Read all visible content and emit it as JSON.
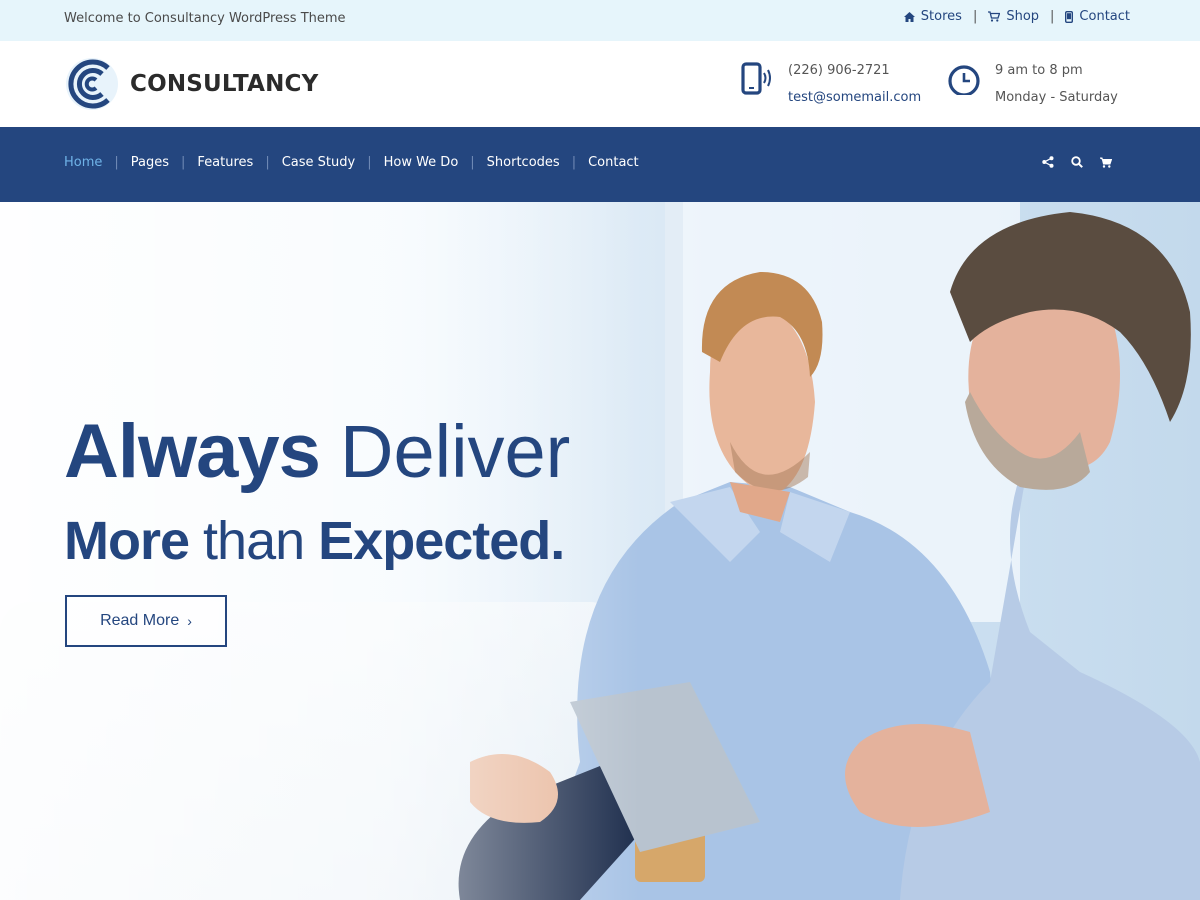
{
  "topbar": {
    "welcome": "Welcome to Consultancy WordPress Theme",
    "links": [
      {
        "label": "Stores",
        "icon": "home-icon"
      },
      {
        "label": "Shop",
        "icon": "cart-icon"
      },
      {
        "label": "Contact",
        "icon": "mobile-icon"
      }
    ],
    "separator": "|"
  },
  "header": {
    "logo_text": "CONSULTANCY",
    "phone": "(226) 906-2721",
    "email": "test@somemail.com",
    "hours": "9 am to 8 pm",
    "days": "Monday - Saturday"
  },
  "nav": {
    "items": [
      "Home",
      "Pages",
      "Features",
      "Case Study",
      "How We Do",
      "Shortcodes",
      "Contact"
    ],
    "active": "Home",
    "separator": "|",
    "icons": [
      "share-icon",
      "search-icon",
      "cart-icon"
    ]
  },
  "hero": {
    "line1_bold": "Always",
    "line1_thin": "Deliver",
    "line2_bold1": "More",
    "line2_thin": "than",
    "line2_bold2": "Expected.",
    "button": "Read More",
    "button_chevron": "›"
  },
  "colors": {
    "brand": "#24467f",
    "topbar_bg": "#e6f5fb",
    "nav_active": "#6fb3e8"
  }
}
